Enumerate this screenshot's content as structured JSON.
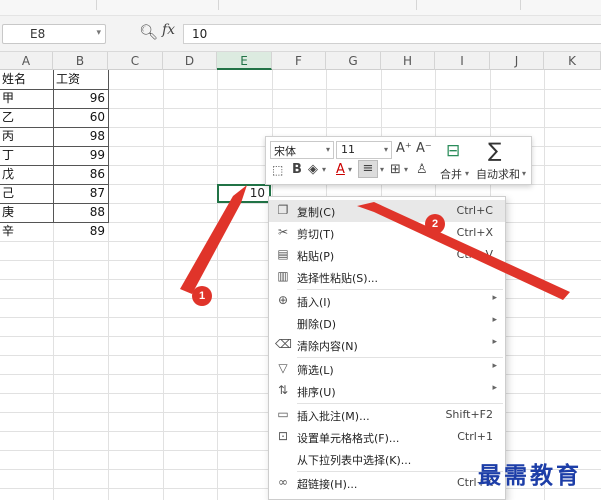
{
  "formula_bar": {
    "name_box": "E8",
    "zoom_icon": "zoom-icon",
    "fx_label": "fx",
    "value": "10"
  },
  "columns": [
    "A",
    "B",
    "C",
    "D",
    "E",
    "F",
    "G",
    "H",
    "I",
    "J",
    "K"
  ],
  "active_column": "E",
  "table": {
    "header": [
      "姓名",
      "工资"
    ],
    "rows": [
      [
        "甲",
        "96"
      ],
      [
        "乙",
        "60"
      ],
      [
        "丙",
        "98"
      ],
      [
        "丁",
        "99"
      ],
      [
        "戊",
        "86"
      ],
      [
        "己",
        "87"
      ],
      [
        "庚",
        "88"
      ],
      [
        "辛",
        "89"
      ]
    ]
  },
  "selected_cell": {
    "ref": "E8",
    "value": "10"
  },
  "mini_toolbar": {
    "font_name": "宋体",
    "font_size": "11",
    "grow_font": "A⁺",
    "shrink_font": "A⁻",
    "bold": "B",
    "font_color": "A",
    "merge_label": "合并",
    "autosum_label": "自动求和",
    "sigma": "∑"
  },
  "context_menu": {
    "items": [
      {
        "icon": "copy-icon",
        "label": "复制(C)",
        "shortcut": "Ctrl+C",
        "submenu": false
      },
      {
        "icon": "cut-icon",
        "label": "剪切(T)",
        "shortcut": "Ctrl+X",
        "submenu": false
      },
      {
        "icon": "paste-icon",
        "label": "粘贴(P)",
        "shortcut": "Ctrl+V",
        "submenu": false
      },
      {
        "icon": "paste-special-icon",
        "label": "选择性粘贴(S)...",
        "shortcut": "",
        "submenu": false
      },
      {
        "icon": "insert-icon",
        "label": "插入(I)",
        "shortcut": "",
        "submenu": true
      },
      {
        "icon": "",
        "label": "删除(D)",
        "shortcut": "",
        "submenu": true
      },
      {
        "icon": "clear-icon",
        "label": "清除内容(N)",
        "shortcut": "",
        "submenu": true
      },
      {
        "icon": "filter-icon",
        "label": "筛选(L)",
        "shortcut": "",
        "submenu": true
      },
      {
        "icon": "sort-icon",
        "label": "排序(U)",
        "shortcut": "",
        "submenu": true
      },
      {
        "icon": "comment-icon",
        "label": "插入批注(M)...",
        "shortcut": "Shift+F2",
        "submenu": false
      },
      {
        "icon": "format-cells-icon",
        "label": "设置单元格格式(F)...",
        "shortcut": "Ctrl+1",
        "submenu": false
      },
      {
        "icon": "",
        "label": "从下拉列表中选择(K)...",
        "shortcut": "",
        "submenu": false
      },
      {
        "icon": "link-icon",
        "label": "超链接(H)...",
        "shortcut": "Ctrl+K",
        "submenu": false
      }
    ]
  },
  "annotations": {
    "badge_1": "1",
    "badge_2": "2",
    "color": "#e0342a"
  },
  "watermark": "最需教育"
}
